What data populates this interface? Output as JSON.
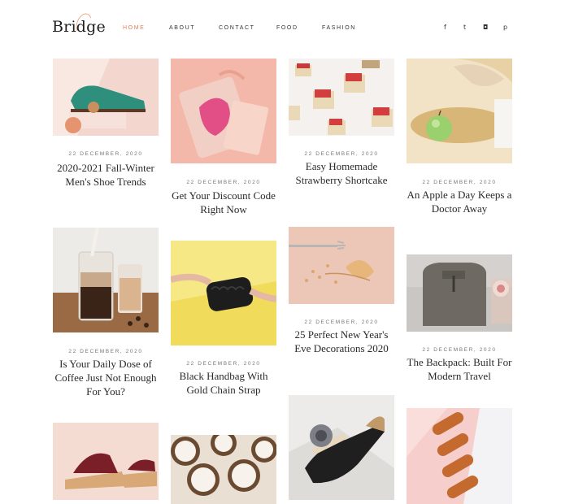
{
  "brand": {
    "name": "Bridge"
  },
  "nav": [
    {
      "label": "HOME",
      "active": true
    },
    {
      "label": "ABOUT",
      "active": false
    },
    {
      "label": "CONTACT",
      "active": false
    },
    {
      "label": "FOOD",
      "active": false
    },
    {
      "label": "FASHION",
      "active": false
    }
  ],
  "social": [
    {
      "icon": "facebook-icon",
      "glyph": "f"
    },
    {
      "icon": "twitter-icon",
      "glyph": "t"
    },
    {
      "icon": "instagram-icon",
      "glyph": "◘"
    },
    {
      "icon": "pinterest-icon",
      "glyph": "p"
    }
  ],
  "colors": {
    "accent": "#e07e56",
    "text": "#2a2a2a",
    "muted": "#777777"
  },
  "posts": [
    {
      "date": "22 DECEMBER, 2020",
      "title": "2020-2021 Fall-Winter Men's Shoe Trends"
    },
    {
      "date": "22 DECEMBER, 2020",
      "title": "Get Your Discount Code Right Now"
    },
    {
      "date": "22 DECEMBER, 2020",
      "title": "Easy Homemade Strawberry Shortcake"
    },
    {
      "date": "22 DECEMBER, 2020",
      "title": "An Apple a Day Keeps a Doctor Away"
    },
    {
      "date": "22 DECEMBER, 2020",
      "title": "Is Your Daily Dose of Coffee Just Not Enough For You?"
    },
    {
      "date": "22 DECEMBER, 2020",
      "title": "Black Handbag With Gold Chain Strap"
    },
    {
      "date": "22 DECEMBER, 2020",
      "title": "25 Perfect New Year's Eve Decorations 2020"
    },
    {
      "date": "22 DECEMBER, 2020",
      "title": "The Backpack: Built For Modern Travel"
    }
  ]
}
